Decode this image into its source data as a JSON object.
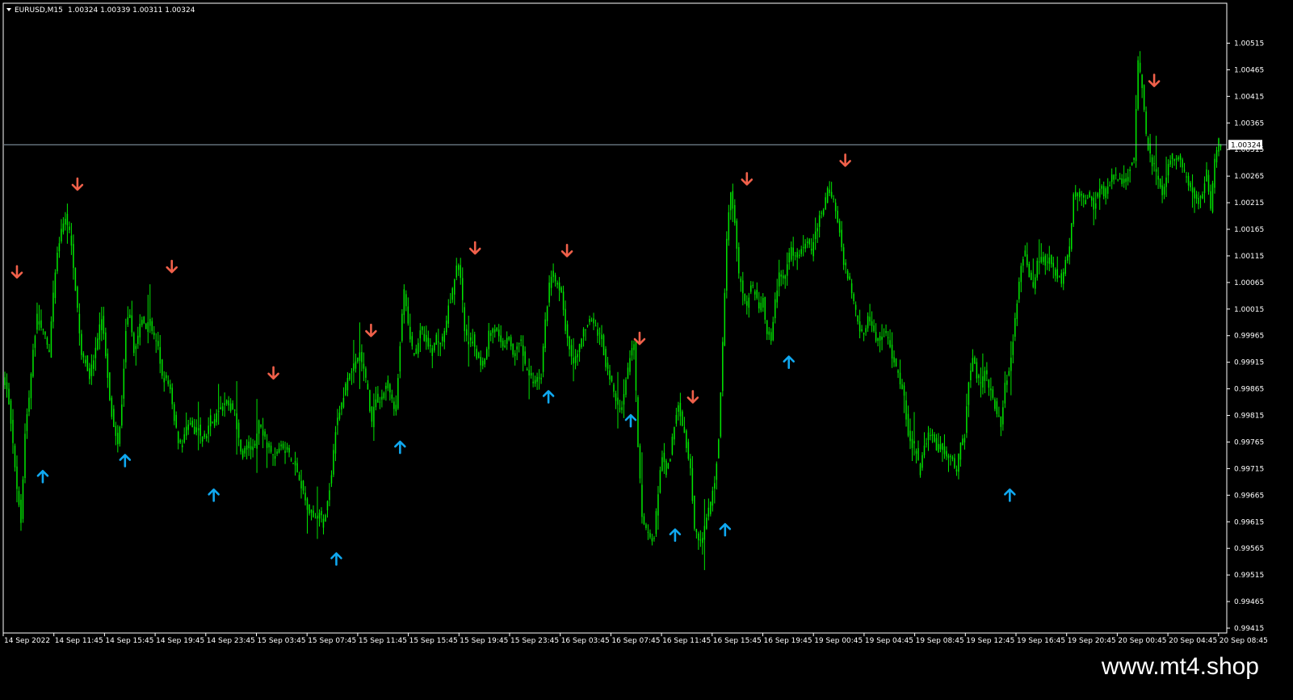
{
  "header": {
    "symbol": "EURUSD,M15",
    "ohlc": "1.00324 1.00339 1.00311 1.00324"
  },
  "current_price_label": "1.00324",
  "watermark": "www.mt4.shop",
  "colors": {
    "background": "#000000",
    "frame": "#ffffff",
    "candle": "#00e600",
    "sell_arrow": "#f0604a",
    "buy_arrow": "#10a8f0",
    "price_line": "#8fa4b4"
  },
  "chart_data": {
    "type": "candlestick",
    "ylim": [
      0.99415,
      1.0054
    ],
    "current_price": 1.00324,
    "y_ticks": [
      "1.00515",
      "1.00465",
      "1.00415",
      "1.00365",
      "1.00315",
      "1.00265",
      "1.00215",
      "1.00165",
      "1.00115",
      "1.00065",
      "1.00015",
      "0.99965",
      "0.99915",
      "0.99865",
      "0.99815",
      "0.99765",
      "0.99715",
      "0.99665",
      "0.99615",
      "0.99565",
      "0.99515",
      "0.99465",
      "0.99415"
    ],
    "x_ticks": [
      "14 Sep 2022",
      "14 Sep 11:45",
      "14 Sep 15:45",
      "14 Sep 19:45",
      "14 Sep 23:45",
      "15 Sep 03:45",
      "15 Sep 07:45",
      "15 Sep 11:45",
      "15 Sep 15:45",
      "15 Sep 19:45",
      "15 Sep 23:45",
      "16 Sep 03:45",
      "16 Sep 07:45",
      "16 Sep 11:45",
      "16 Sep 15:45",
      "16 Sep 19:45",
      "19 Sep 00:45",
      "19 Sep 04:45",
      "19 Sep 08:45",
      "19 Sep 12:45",
      "19 Sep 16:45",
      "19 Sep 20:45",
      "20 Sep 00:45",
      "20 Sep 04:45",
      "20 Sep 08:45"
    ],
    "price_path": [
      [
        0,
        0.9988
      ],
      [
        5,
        0.9984
      ],
      [
        10,
        0.9976
      ],
      [
        15,
        0.9968
      ],
      [
        20,
        0.9962
      ],
      [
        25,
        0.9978
      ],
      [
        30,
        0.9985
      ],
      [
        35,
        0.9994
      ],
      [
        40,
        1.0
      ],
      [
        45,
        0.9998
      ],
      [
        50,
        0.9996
      ],
      [
        55,
        0.9993
      ],
      [
        60,
        1.0004
      ],
      [
        65,
        1.0012
      ],
      [
        70,
        1.0016
      ],
      [
        75,
        1.0019
      ],
      [
        80,
        1.0016
      ],
      [
        85,
        1.001
      ],
      [
        90,
        1.0001
      ],
      [
        95,
        0.9993
      ],
      [
        100,
        0.9992
      ],
      [
        105,
        0.9989
      ],
      [
        110,
        0.9992
      ],
      [
        115,
        0.9996
      ],
      [
        120,
        1.0
      ],
      [
        125,
        0.9993
      ],
      [
        130,
        0.9985
      ],
      [
        135,
        0.9979
      ],
      [
        140,
        0.9976
      ],
      [
        145,
        0.9984
      ],
      [
        150,
        0.9998
      ],
      [
        155,
        1.0001
      ],
      [
        160,
        0.9994
      ],
      [
        165,
        0.9996
      ],
      [
        170,
        1.0
      ],
      [
        175,
        0.9998
      ],
      [
        180,
        0.9999
      ],
      [
        185,
        0.9996
      ],
      [
        190,
        0.9994
      ],
      [
        195,
        0.9989
      ],
      [
        200,
        0.9988
      ],
      [
        205,
        0.9986
      ],
      [
        210,
        0.9981
      ],
      [
        215,
        0.9977
      ],
      [
        220,
        0.9976
      ],
      [
        225,
        0.9979
      ],
      [
        230,
        0.998
      ],
      [
        235,
        0.9978
      ],
      [
        240,
        0.9979
      ],
      [
        245,
        0.9977
      ],
      [
        250,
        0.9978
      ],
      [
        255,
        0.9981
      ],
      [
        260,
        0.998
      ],
      [
        265,
        0.9983
      ],
      [
        270,
        0.9983
      ],
      [
        275,
        0.9984
      ],
      [
        280,
        0.9983
      ],
      [
        285,
        0.9982
      ],
      [
        290,
        0.9977
      ],
      [
        295,
        0.9974
      ],
      [
        300,
        0.9976
      ],
      [
        305,
        0.9975
      ],
      [
        310,
        0.9976
      ],
      [
        315,
        0.998
      ],
      [
        320,
        0.9978
      ],
      [
        325,
        0.9976
      ],
      [
        330,
        0.9975
      ],
      [
        335,
        0.9974
      ],
      [
        340,
        0.9976
      ],
      [
        345,
        0.9975
      ],
      [
        350,
        0.9975
      ],
      [
        355,
        0.9973
      ],
      [
        360,
        0.9972
      ],
      [
        365,
        0.997
      ],
      [
        370,
        0.9967
      ],
      [
        375,
        0.9964
      ],
      [
        380,
        0.9963
      ],
      [
        385,
        0.9962
      ],
      [
        390,
        0.9963
      ],
      [
        395,
        0.9961
      ],
      [
        400,
        0.9965
      ],
      [
        405,
        0.9971
      ],
      [
        410,
        0.9979
      ],
      [
        415,
        0.9982
      ],
      [
        420,
        0.9985
      ],
      [
        425,
        0.9989
      ],
      [
        430,
        0.999
      ],
      [
        435,
        0.9991
      ],
      [
        440,
        0.9993
      ],
      [
        445,
        0.999
      ],
      [
        450,
        0.9986
      ],
      [
        455,
        0.998
      ],
      [
        460,
        0.9985
      ],
      [
        465,
        0.9984
      ],
      [
        470,
        0.9986
      ],
      [
        475,
        0.9988
      ],
      [
        480,
        0.9984
      ],
      [
        485,
        0.9983
      ],
      [
        490,
        0.9995
      ],
      [
        495,
        1.0005
      ],
      [
        500,
        0.9998
      ],
      [
        505,
        0.9994
      ],
      [
        510,
        0.9993
      ],
      [
        515,
        0.9998
      ],
      [
        520,
        0.9996
      ],
      [
        525,
        0.9995
      ],
      [
        530,
        0.9993
      ],
      [
        535,
        0.9996
      ],
      [
        540,
        0.9995
      ],
      [
        545,
        0.9997
      ],
      [
        550,
        1.0002
      ],
      [
        555,
        1.0005
      ],
      [
        560,
        1.001
      ],
      [
        565,
        1.0008
      ],
      [
        570,
        0.9997
      ],
      [
        575,
        0.9995
      ],
      [
        580,
        0.9996
      ],
      [
        585,
        0.9993
      ],
      [
        590,
        0.9991
      ],
      [
        595,
        0.9992
      ],
      [
        600,
        0.9997
      ],
      [
        605,
        0.9998
      ],
      [
        610,
        0.9997
      ],
      [
        615,
        0.9995
      ],
      [
        620,
        0.9995
      ],
      [
        625,
        0.9996
      ],
      [
        630,
        0.9993
      ],
      [
        635,
        0.9995
      ],
      [
        640,
        0.9995
      ],
      [
        645,
        0.9991
      ],
      [
        650,
        0.9989
      ],
      [
        655,
        0.9988
      ],
      [
        660,
        0.9988
      ],
      [
        665,
        0.9989
      ],
      [
        670,
        0.9999
      ],
      [
        675,
        1.0006
      ],
      [
        680,
        1.0008
      ],
      [
        685,
        1.0006
      ],
      [
        690,
        1.0004
      ],
      [
        695,
        0.9998
      ],
      [
        700,
        0.9994
      ],
      [
        705,
        0.9992
      ],
      [
        710,
        0.9993
      ],
      [
        715,
        0.9996
      ],
      [
        720,
        0.9998
      ],
      [
        725,
        0.9999
      ],
      [
        730,
        0.9999
      ],
      [
        735,
        0.9997
      ],
      [
        740,
        0.9996
      ],
      [
        745,
        0.9991
      ],
      [
        750,
        0.9989
      ],
      [
        755,
        0.9986
      ],
      [
        760,
        0.9983
      ],
      [
        765,
        0.9983
      ],
      [
        770,
        0.9988
      ],
      [
        775,
        0.9992
      ],
      [
        780,
        0.9995
      ],
      [
        785,
        0.9976
      ],
      [
        790,
        0.9962
      ],
      [
        795,
        0.996
      ],
      [
        800,
        0.9958
      ],
      [
        805,
        0.9959
      ],
      [
        810,
        0.9967
      ],
      [
        815,
        0.9974
      ],
      [
        820,
        0.9971
      ],
      [
        825,
        0.9974
      ],
      [
        830,
        0.998
      ],
      [
        835,
        0.9984
      ],
      [
        840,
        0.998
      ],
      [
        845,
        0.9976
      ],
      [
        850,
        0.9972
      ],
      [
        855,
        0.996
      ],
      [
        860,
        0.9958
      ],
      [
        865,
        0.9958
      ],
      [
        870,
        0.9962
      ],
      [
        875,
        0.9965
      ],
      [
        880,
        0.9969
      ],
      [
        885,
        0.9977
      ],
      [
        890,
        0.9995
      ],
      [
        895,
        1.0015
      ],
      [
        900,
        1.0024
      ],
      [
        905,
        1.0018
      ],
      [
        910,
        1.0008
      ],
      [
        915,
        1.0005
      ],
      [
        920,
        1.0002
      ],
      [
        925,
        1.0006
      ],
      [
        930,
        1.0005
      ],
      [
        935,
        1.0002
      ],
      [
        940,
        1.0003
      ],
      [
        945,
        0.9997
      ],
      [
        950,
        0.9996
      ],
      [
        955,
        1.0003
      ],
      [
        960,
        1.0008
      ],
      [
        965,
        1.0007
      ],
      [
        970,
        1.001
      ],
      [
        975,
        1.0013
      ],
      [
        980,
        1.0011
      ],
      [
        985,
        1.0012
      ],
      [
        990,
        1.0013
      ],
      [
        995,
        1.0014
      ],
      [
        1000,
        1.0012
      ],
      [
        1005,
        1.0016
      ],
      [
        1010,
        1.0019
      ],
      [
        1015,
        1.002
      ],
      [
        1020,
        1.0024
      ],
      [
        1025,
        1.0023
      ],
      [
        1030,
        1.002
      ],
      [
        1035,
        1.0016
      ],
      [
        1040,
        1.001
      ],
      [
        1045,
        1.0008
      ],
      [
        1050,
        1.0005
      ],
      [
        1055,
        1.0001
      ],
      [
        1060,
        0.9998
      ],
      [
        1065,
        0.9997
      ],
      [
        1070,
        1.0
      ],
      [
        1075,
        0.9998
      ],
      [
        1080,
        0.9996
      ],
      [
        1085,
        0.9996
      ],
      [
        1090,
        0.9997
      ],
      [
        1095,
        0.9996
      ],
      [
        1100,
        0.9993
      ],
      [
        1105,
        0.999
      ],
      [
        1110,
        0.9988
      ],
      [
        1115,
        0.9985
      ],
      [
        1120,
        0.9978
      ],
      [
        1125,
        0.9976
      ],
      [
        1130,
        0.9975
      ],
      [
        1135,
        0.9971
      ],
      [
        1140,
        0.9976
      ],
      [
        1145,
        0.9978
      ],
      [
        1150,
        0.9978
      ],
      [
        1155,
        0.9975
      ],
      [
        1160,
        0.9976
      ],
      [
        1165,
        0.9975
      ],
      [
        1170,
        0.9974
      ],
      [
        1175,
        0.9973
      ],
      [
        1180,
        0.9971
      ],
      [
        1185,
        0.9976
      ],
      [
        1190,
        0.9978
      ],
      [
        1195,
        0.9988
      ],
      [
        1200,
        0.9993
      ],
      [
        1205,
        0.9989
      ],
      [
        1210,
        0.9987
      ],
      [
        1215,
        0.999
      ],
      [
        1220,
        0.9987
      ],
      [
        1225,
        0.9985
      ],
      [
        1230,
        0.9982
      ],
      [
        1235,
        0.998
      ],
      [
        1240,
        0.9987
      ],
      [
        1245,
        0.999
      ],
      [
        1250,
        0.9996
      ],
      [
        1255,
        1.0003
      ],
      [
        1260,
        1.001
      ],
      [
        1265,
        1.0012
      ],
      [
        1270,
        1.0008
      ],
      [
        1275,
        1.0006
      ],
      [
        1280,
        1.001
      ],
      [
        1285,
        1.0012
      ],
      [
        1290,
        1.001
      ],
      [
        1295,
        1.0011
      ],
      [
        1300,
        1.0009
      ],
      [
        1305,
        1.0008
      ],
      [
        1310,
        1.0007
      ],
      [
        1315,
        1.001
      ],
      [
        1320,
        1.0013
      ],
      [
        1325,
        1.0023
      ],
      [
        1330,
        1.0023
      ],
      [
        1335,
        1.0023
      ],
      [
        1340,
        1.0022
      ],
      [
        1345,
        1.0023
      ],
      [
        1350,
        1.0021
      ],
      [
        1355,
        1.0023
      ],
      [
        1360,
        1.0024
      ],
      [
        1365,
        1.0023
      ],
      [
        1370,
        1.0025
      ],
      [
        1375,
        1.0027
      ],
      [
        1380,
        1.0026
      ],
      [
        1385,
        1.0025
      ],
      [
        1390,
        1.0026
      ],
      [
        1395,
        1.0028
      ],
      [
        1400,
        1.003
      ],
      [
        1405,
        1.0048
      ],
      [
        1410,
        1.0043
      ],
      [
        1415,
        1.0034
      ],
      [
        1420,
        1.003
      ],
      [
        1425,
        1.0028
      ],
      [
        1430,
        1.0026
      ],
      [
        1435,
        1.0023
      ],
      [
        1440,
        1.0026
      ],
      [
        1445,
        1.003
      ],
      [
        1450,
        1.0029
      ],
      [
        1455,
        1.003
      ],
      [
        1460,
        1.0028
      ],
      [
        1465,
        1.0026
      ],
      [
        1470,
        1.0025
      ],
      [
        1475,
        1.0023
      ],
      [
        1480,
        1.0022
      ],
      [
        1485,
        1.0023
      ],
      [
        1490,
        1.0027
      ],
      [
        1495,
        1.002
      ],
      [
        1500,
        1.0029
      ],
      [
        1505,
        1.0033
      ],
      [
        1508,
        1.00324
      ]
    ],
    "sell_arrows": [
      [
        15,
        1.00085
      ],
      [
        90,
        1.0025
      ],
      [
        207,
        1.00095
      ],
      [
        333,
        0.99895
      ],
      [
        454,
        0.99975
      ],
      [
        583,
        1.0013
      ],
      [
        697,
        1.00125
      ],
      [
        787,
        0.9996
      ],
      [
        853,
        0.9985
      ],
      [
        920,
        1.0026
      ],
      [
        1042,
        1.00295
      ],
      [
        1425,
        1.00445
      ]
    ],
    "buy_arrows": [
      [
        47,
        0.997
      ],
      [
        149,
        0.9973
      ],
      [
        259,
        0.99665
      ],
      [
        411,
        0.99545
      ],
      [
        490,
        0.99755
      ],
      [
        674,
        0.9985
      ],
      [
        776,
        0.99805
      ],
      [
        831,
        0.9959
      ],
      [
        893,
        0.996
      ],
      [
        972,
        0.99915
      ],
      [
        1246,
        0.99665
      ]
    ]
  }
}
